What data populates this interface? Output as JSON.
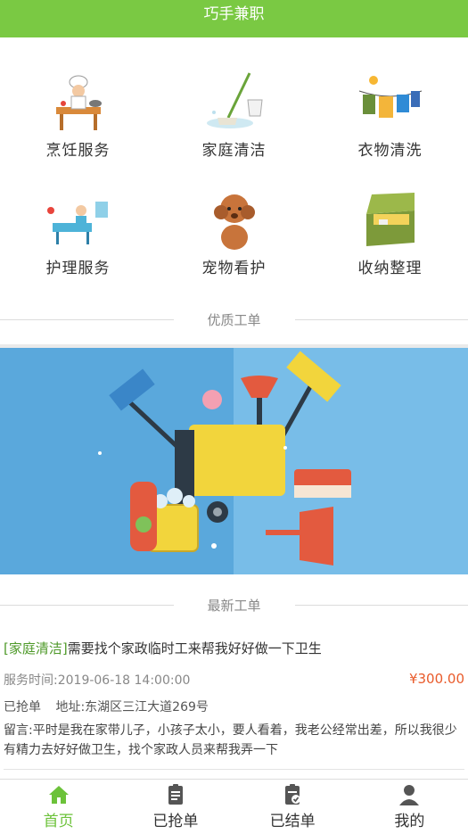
{
  "header": {
    "title": "巧手兼职"
  },
  "services": [
    {
      "label": "烹饪服务",
      "icon": "chef-icon"
    },
    {
      "label": "家庭清洁",
      "icon": "mop-icon"
    },
    {
      "label": "衣物清洗",
      "icon": "laundry-icon"
    },
    {
      "label": "护理服务",
      "icon": "care-icon"
    },
    {
      "label": "宠物看护",
      "icon": "pet-icon"
    },
    {
      "label": "收纳整理",
      "icon": "storage-box-icon"
    }
  ],
  "sections": {
    "quality": "优质工单",
    "latest": "最新工单"
  },
  "order": {
    "tag": "[家庭清洁]",
    "title": "需要找个家政临时工来帮我好好做一下卫生",
    "service_time": "服务时间:2019-06-18 14:00:00",
    "price": "¥300.00",
    "status": "已抢单",
    "address": "地址:东湖区三江大道269号",
    "note": "留言:平时是我在家带儿子，小孩子太小，要人看着，我老公经常出差，所以我很少有精力去好好做卫生，找个家政人员来帮我弄一下"
  },
  "tabs": [
    {
      "label": "首页",
      "icon": "home-icon",
      "active": true
    },
    {
      "label": "已抢单",
      "icon": "grabbed-orders-icon",
      "active": false
    },
    {
      "label": "已结单",
      "icon": "closed-orders-icon",
      "active": false
    },
    {
      "label": "我的",
      "icon": "user-icon",
      "active": false
    }
  ],
  "colors": {
    "accent": "#7ac943",
    "price": "#e95b2b",
    "tag": "#4f9a2a",
    "banner": "#5ca9dd"
  }
}
